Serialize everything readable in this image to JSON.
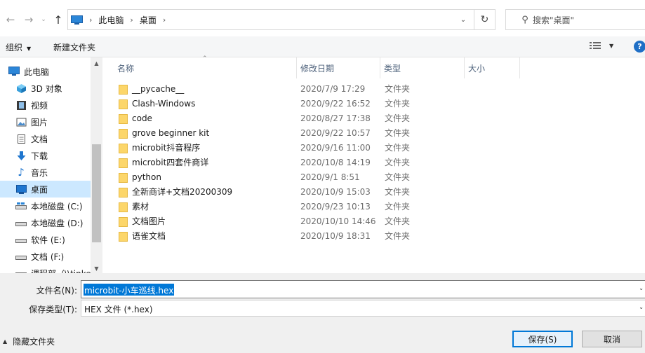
{
  "address": {
    "breadcrumbs": [
      "此电脑",
      "桌面"
    ],
    "search_placeholder": "搜索\"桌面\""
  },
  "toolbar": {
    "organize_label": "组织",
    "new_folder_label": "新建文件夹"
  },
  "nav": {
    "items": [
      {
        "label": "此电脑",
        "icon": "pc-icon"
      },
      {
        "label": "3D 对象",
        "icon": "cube-icon"
      },
      {
        "label": "视频",
        "icon": "video-icon"
      },
      {
        "label": "图片",
        "icon": "picture-icon"
      },
      {
        "label": "文档",
        "icon": "document-icon"
      },
      {
        "label": "下载",
        "icon": "download-icon"
      },
      {
        "label": "音乐",
        "icon": "music-icon"
      },
      {
        "label": "桌面",
        "icon": "desktop-icon",
        "selected": true
      },
      {
        "label": "本地磁盘 (C:)",
        "icon": "drive-icon"
      },
      {
        "label": "本地磁盘 (D:)",
        "icon": "drive-icon"
      },
      {
        "label": "软件 (E:)",
        "icon": "drive-icon"
      },
      {
        "label": "文档 (F:)",
        "icon": "drive-icon"
      },
      {
        "label": "课程部（\\\\tinker",
        "icon": "network-drive-icon"
      }
    ]
  },
  "columns": {
    "name": "名称",
    "date": "修改日期",
    "type": "类型",
    "size": "大小"
  },
  "files": [
    {
      "name": "__pycache__",
      "date": "2020/7/9 17:29",
      "type": "文件夹"
    },
    {
      "name": "Clash-Windows",
      "date": "2020/9/22 16:52",
      "type": "文件夹"
    },
    {
      "name": "code",
      "date": "2020/8/27 17:38",
      "type": "文件夹"
    },
    {
      "name": "grove beginner kit",
      "date": "2020/9/22 10:57",
      "type": "文件夹"
    },
    {
      "name": "microbit抖音程序",
      "date": "2020/9/16 11:00",
      "type": "文件夹"
    },
    {
      "name": "microbit四套件商详",
      "date": "2020/10/8 14:19",
      "type": "文件夹"
    },
    {
      "name": "python",
      "date": "2020/9/1 8:51",
      "type": "文件夹"
    },
    {
      "name": "全新商详+文档20200309",
      "date": "2020/10/9 15:03",
      "type": "文件夹"
    },
    {
      "name": "素材",
      "date": "2020/9/23 10:13",
      "type": "文件夹"
    },
    {
      "name": "文档图片",
      "date": "2020/10/10 14:46",
      "type": "文件夹"
    },
    {
      "name": "语雀文档",
      "date": "2020/10/9 18:31",
      "type": "文件夹"
    }
  ],
  "bottom": {
    "filename_label": "文件名(N):",
    "filename_value": "microbit-小车巡线.hex",
    "filetype_label": "保存类型(T):",
    "filetype_value": "HEX 文件 (*.hex)",
    "hide_folders_label": "隐藏文件夹",
    "save_label": "保存(S)",
    "cancel_label": "取消"
  },
  "colors": {
    "accent": "#0078d7",
    "selected_bg": "#cce8ff",
    "folder": "#fcd66a"
  }
}
